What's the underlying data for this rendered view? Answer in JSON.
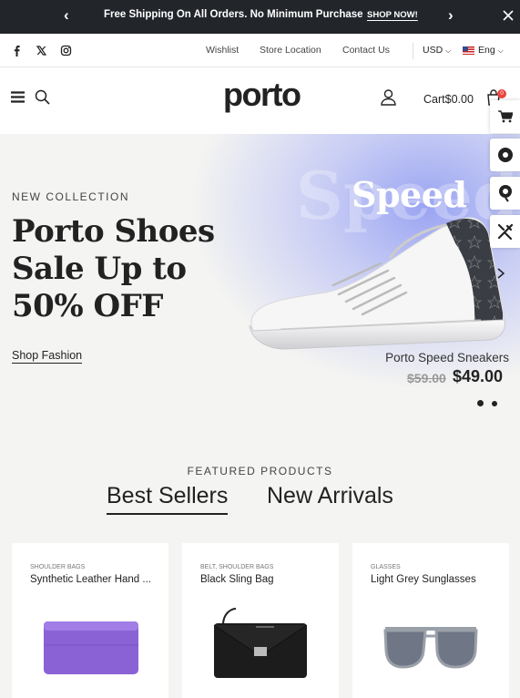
{
  "announcement": {
    "message": "Free Shipping On All Orders. No Minimum Purchase",
    "cta": "SHOP NOW!"
  },
  "utility": {
    "links": [
      "Wishlist",
      "Store Location",
      "Contact Us"
    ],
    "currency": "USD",
    "language": "Eng"
  },
  "header": {
    "logo": "porto",
    "cart_label": "Cart",
    "cart_total": "$0.00",
    "cart_count": "0"
  },
  "hero": {
    "eyebrow": "NEW COLLECTION",
    "headline": [
      "Porto Shoes",
      "Sale Up to",
      "50% OFF"
    ],
    "cta": "Shop Fashion",
    "badge_text": "Speed",
    "product_name": "Porto Speed Sneakers",
    "old_price": "$59.00",
    "new_price": "$49.00"
  },
  "featured": {
    "eyebrow": "FEATURED PRODUCTS",
    "tabs": [
      "Best Sellers",
      "New Arrivals"
    ],
    "active_tab": "Best Sellers",
    "products": [
      {
        "category": "SHOULDER BAGS",
        "name": "Synthetic Leather Hand ...",
        "image": "purple-clutch",
        "color": "#8a62d6"
      },
      {
        "category": "BELT, SHOULDER BAGS",
        "name": "Black Sling Bag",
        "image": "black-bag",
        "color": "#1c1c1c"
      },
      {
        "category": "GLASSES",
        "name": "Light Grey Sunglasses",
        "image": "sunglasses",
        "color": "#9aa0a8"
      }
    ]
  },
  "icons": [
    "chevron-left-icon",
    "chevron-right-icon",
    "close-icon",
    "facebook-icon",
    "x-icon",
    "instagram-icon",
    "menu-icon",
    "search-icon",
    "user-icon",
    "cart-icon",
    "shopping-cart-icon",
    "disc-icon",
    "pin-icon",
    "tools-icon"
  ]
}
